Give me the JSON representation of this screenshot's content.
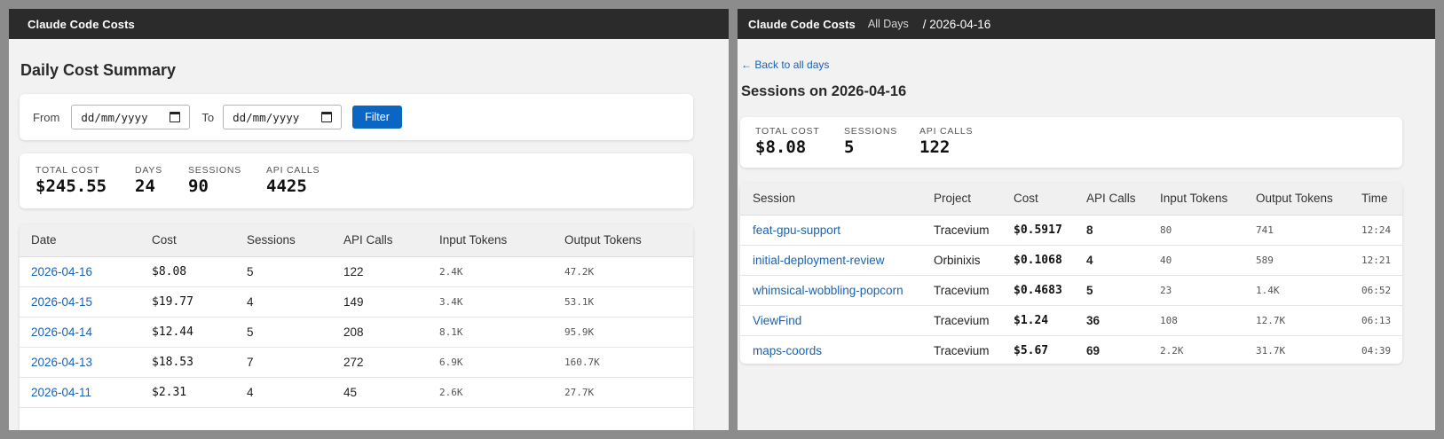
{
  "left": {
    "brand": "Claude Code Costs",
    "page_title": "Daily Cost Summary",
    "filter": {
      "from_label": "From",
      "from_value": "dd/mm/yyyy",
      "to_label": "To",
      "to_value": "dd/mm/yyyy",
      "button_label": "Filter"
    },
    "stats": [
      {
        "label": "Total Cost",
        "value": "$245.55"
      },
      {
        "label": "Days",
        "value": "24"
      },
      {
        "label": "Sessions",
        "value": "90"
      },
      {
        "label": "API Calls",
        "value": "4425"
      }
    ],
    "table": {
      "headers": [
        "Date",
        "Cost",
        "Sessions",
        "API Calls",
        "Input Tokens",
        "Output Tokens"
      ],
      "rows": [
        {
          "date": "2026-04-16",
          "cost": "$8.08",
          "sessions": "5",
          "api_calls": "122",
          "input_tokens": "2.4K",
          "output_tokens": "47.2K"
        },
        {
          "date": "2026-04-15",
          "cost": "$19.77",
          "sessions": "4",
          "api_calls": "149",
          "input_tokens": "3.4K",
          "output_tokens": "53.1K"
        },
        {
          "date": "2026-04-14",
          "cost": "$12.44",
          "sessions": "5",
          "api_calls": "208",
          "input_tokens": "8.1K",
          "output_tokens": "95.9K"
        },
        {
          "date": "2026-04-13",
          "cost": "$18.53",
          "sessions": "7",
          "api_calls": "272",
          "input_tokens": "6.9K",
          "output_tokens": "160.7K"
        },
        {
          "date": "2026-04-11",
          "cost": "$2.31",
          "sessions": "4",
          "api_calls": "45",
          "input_tokens": "2.6K",
          "output_tokens": "27.7K"
        }
      ]
    }
  },
  "right": {
    "brand": "Claude Code Costs",
    "nav_all_days": "All Days",
    "breadcrumb": "/ 2026-04-16",
    "back_link": "← Back to all days",
    "page_title": "Sessions on 2026-04-16",
    "stats": [
      {
        "label": "Total Cost",
        "value": "$8.08"
      },
      {
        "label": "Sessions",
        "value": "5"
      },
      {
        "label": "API Calls",
        "value": "122"
      }
    ],
    "table": {
      "headers": [
        "Session",
        "Project",
        "Cost",
        "API Calls",
        "Input Tokens",
        "Output Tokens",
        "Time"
      ],
      "rows": [
        {
          "session": "feat-gpu-support",
          "project": "Tracevium",
          "cost": "$0.5917",
          "api_calls": "8",
          "input_tokens": "80",
          "output_tokens": "741",
          "time": "12:24"
        },
        {
          "session": "initial-deployment-review",
          "project": "Orbinixis",
          "cost": "$0.1068",
          "api_calls": "4",
          "input_tokens": "40",
          "output_tokens": "589",
          "time": "12:21"
        },
        {
          "session": "whimsical-wobbling-popcorn",
          "project": "Tracevium",
          "cost": "$0.4683",
          "api_calls": "5",
          "input_tokens": "23",
          "output_tokens": "1.4K",
          "time": "06:52"
        },
        {
          "session": "ViewFind",
          "project": "Tracevium",
          "cost": "$1.24",
          "api_calls": "36",
          "input_tokens": "108",
          "output_tokens": "12.7K",
          "time": "06:13"
        },
        {
          "session": "maps-coords",
          "project": "Tracevium",
          "cost": "$5.67",
          "api_calls": "69",
          "input_tokens": "2.2K",
          "output_tokens": "31.7K",
          "time": "04:39"
        }
      ]
    }
  },
  "colors": {
    "topbar": "#2b2b2b",
    "background": "#f2f2f2",
    "link": "#1863b5",
    "button": "#0b66c3"
  }
}
